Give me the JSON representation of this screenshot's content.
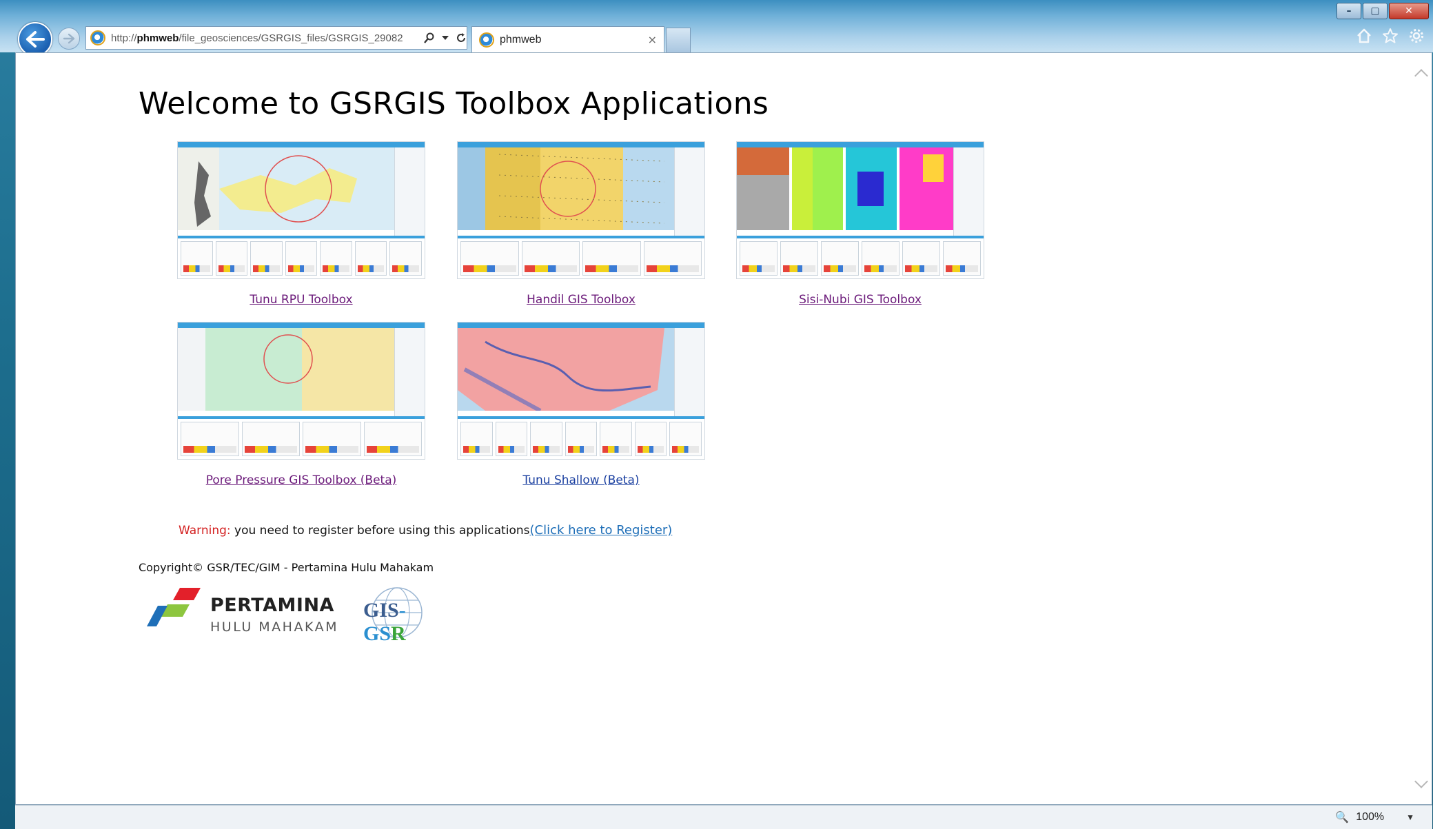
{
  "browser": {
    "url_prefix": "http://",
    "url_host": "phmweb",
    "url_path": "/file_geosciences/GSRGIS_files/GSRGIS_29082",
    "tab_title": "phmweb",
    "tab_close": "×",
    "window_buttons": {
      "minimize": "–",
      "maximize": "▢",
      "close": "✕"
    },
    "toolbar_icons": [
      "home-icon",
      "favorites-star-icon",
      "settings-gear-icon"
    ],
    "zoom": "100%",
    "accent_color": "#1a5fb0"
  },
  "page": {
    "title": "Welcome to GSRGIS Toolbox Applications",
    "apps": [
      {
        "label": "Tunu RPU Toolbox"
      },
      {
        "label": "Handil GIS Toolbox"
      },
      {
        "label": "Sisi-Nubi GIS Toolbox"
      },
      {
        "label": "Pore Pressure GIS Toolbox (Beta)"
      },
      {
        "label": "Tunu Shallow (Beta)"
      }
    ],
    "warning_label": "Warning:",
    "warning_text": " you need to register before using this applications",
    "register_link": "(Click here to Register)",
    "copyright": "Copyright© GSR/TEC/GIM - Pertamina Hulu Mahakam",
    "logos": {
      "pertamina_name": "PERTAMINA",
      "pertamina_sub": "HULU MAHAKAM",
      "gis_a": "GIS",
      "gis_b": "-GS",
      "gis_c": "R"
    }
  }
}
